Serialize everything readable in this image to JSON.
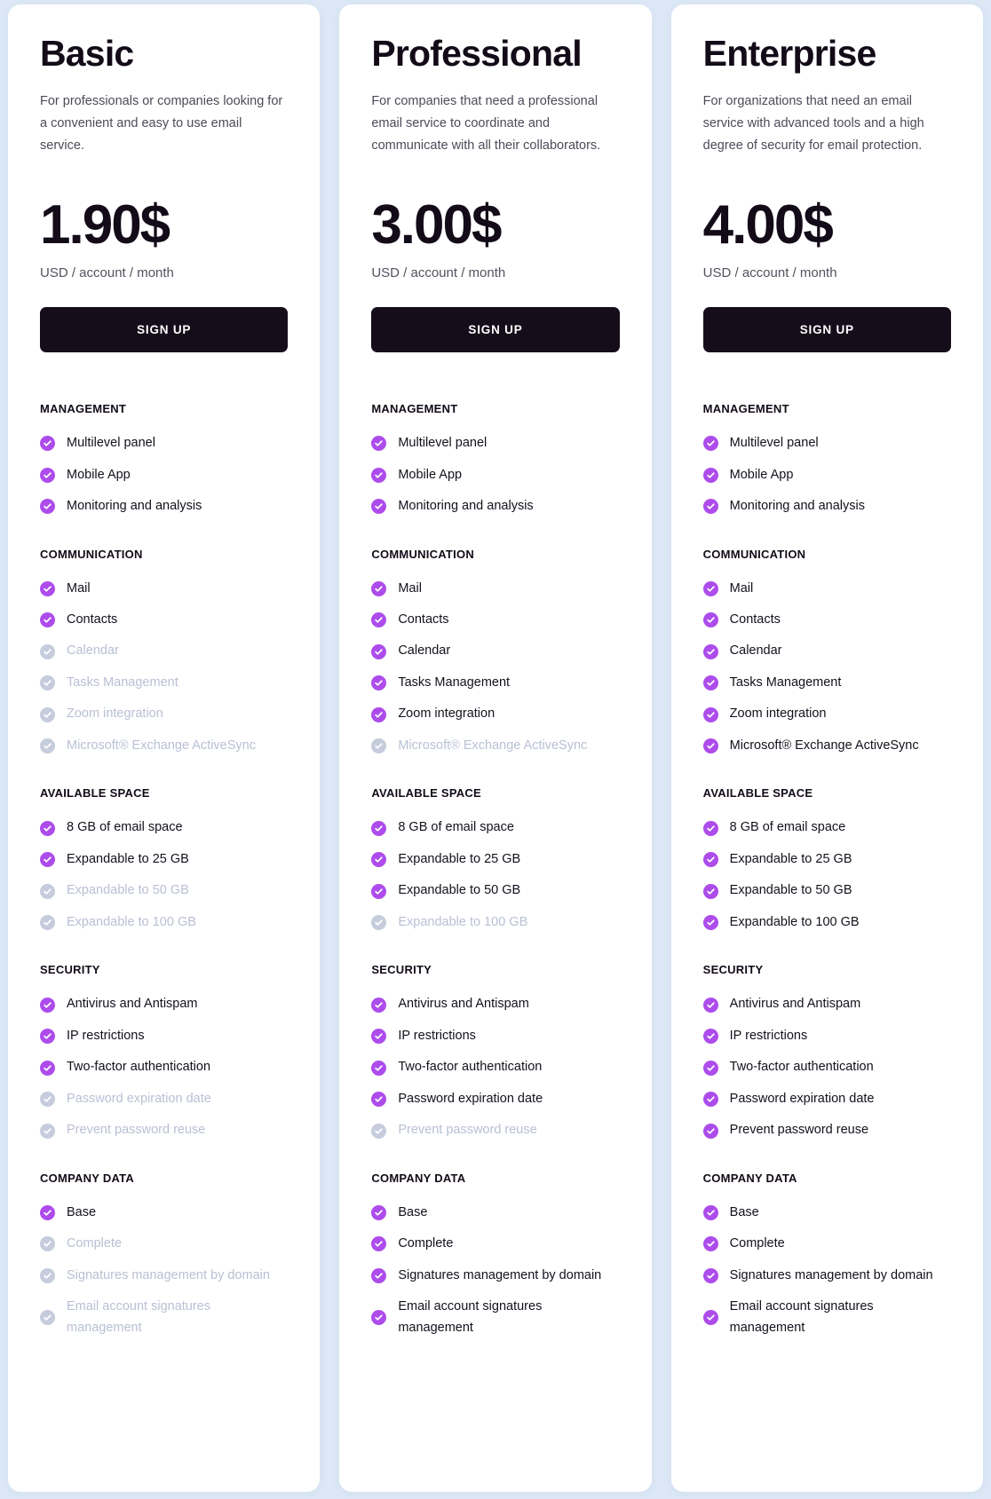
{
  "theme": {
    "page_background": "#dce8f6",
    "card_background": "#ffffff",
    "accent": "#ad4ceb",
    "disabled": "#c5ccdc",
    "button_background": "#150d1a",
    "heading_color": "#130b18"
  },
  "icons": {
    "check": "check-circle-icon"
  },
  "plans": [
    {
      "name": "Basic",
      "description": "For professionals or companies looking for a convenient and easy to use email service.",
      "price": "1.90$",
      "price_unit": "USD / account / month",
      "cta_label": "SIGN UP",
      "sections": [
        {
          "title": "MANAGEMENT",
          "features": [
            {
              "label": "Multilevel panel",
              "enabled": true
            },
            {
              "label": "Mobile App",
              "enabled": true
            },
            {
              "label": "Monitoring and analysis",
              "enabled": true
            }
          ]
        },
        {
          "title": "COMMUNICATION",
          "features": [
            {
              "label": "Mail",
              "enabled": true
            },
            {
              "label": "Contacts",
              "enabled": true
            },
            {
              "label": "Calendar",
              "enabled": false
            },
            {
              "label": "Tasks Management",
              "enabled": false
            },
            {
              "label": "Zoom integration",
              "enabled": false
            },
            {
              "label": "Microsoft® Exchange ActiveSync",
              "enabled": false
            }
          ]
        },
        {
          "title": "AVAILABLE SPACE",
          "features": [
            {
              "label": "8 GB of email space",
              "enabled": true
            },
            {
              "label": "Expandable to 25 GB",
              "enabled": true
            },
            {
              "label": "Expandable to 50 GB",
              "enabled": false
            },
            {
              "label": "Expandable to 100 GB",
              "enabled": false
            }
          ]
        },
        {
          "title": "SECURITY",
          "features": [
            {
              "label": "Antivirus and Antispam",
              "enabled": true
            },
            {
              "label": "IP restrictions",
              "enabled": true
            },
            {
              "label": "Two-factor authentication",
              "enabled": true
            },
            {
              "label": "Password expiration date",
              "enabled": false
            },
            {
              "label": "Prevent password reuse",
              "enabled": false
            }
          ]
        },
        {
          "title": "COMPANY DATA",
          "features": [
            {
              "label": "Base",
              "enabled": true
            },
            {
              "label": "Complete",
              "enabled": false
            },
            {
              "label": "Signatures management by domain",
              "enabled": false
            },
            {
              "label": "Email account signatures management",
              "enabled": false
            }
          ]
        }
      ]
    },
    {
      "name": "Professional",
      "description": "For companies that need a professional email service to coordinate and communicate with all their collaborators.",
      "price": "3.00$",
      "price_unit": "USD / account / month",
      "cta_label": "SIGN UP",
      "sections": [
        {
          "title": "MANAGEMENT",
          "features": [
            {
              "label": "Multilevel panel",
              "enabled": true
            },
            {
              "label": "Mobile App",
              "enabled": true
            },
            {
              "label": "Monitoring and analysis",
              "enabled": true
            }
          ]
        },
        {
          "title": "COMMUNICATION",
          "features": [
            {
              "label": "Mail",
              "enabled": true
            },
            {
              "label": "Contacts",
              "enabled": true
            },
            {
              "label": "Calendar",
              "enabled": true
            },
            {
              "label": "Tasks Management",
              "enabled": true
            },
            {
              "label": "Zoom integration",
              "enabled": true
            },
            {
              "label": "Microsoft® Exchange ActiveSync",
              "enabled": false
            }
          ]
        },
        {
          "title": "AVAILABLE SPACE",
          "features": [
            {
              "label": "8 GB of email space",
              "enabled": true
            },
            {
              "label": "Expandable to 25 GB",
              "enabled": true
            },
            {
              "label": "Expandable to 50 GB",
              "enabled": true
            },
            {
              "label": "Expandable to 100 GB",
              "enabled": false
            }
          ]
        },
        {
          "title": "SECURITY",
          "features": [
            {
              "label": "Antivirus and Antispam",
              "enabled": true
            },
            {
              "label": "IP restrictions",
              "enabled": true
            },
            {
              "label": "Two-factor authentication",
              "enabled": true
            },
            {
              "label": "Password expiration date",
              "enabled": true
            },
            {
              "label": "Prevent password reuse",
              "enabled": false
            }
          ]
        },
        {
          "title": "COMPANY DATA",
          "features": [
            {
              "label": "Base",
              "enabled": true
            },
            {
              "label": "Complete",
              "enabled": true
            },
            {
              "label": "Signatures management by domain",
              "enabled": true
            },
            {
              "label": "Email account signatures management",
              "enabled": true
            }
          ]
        }
      ]
    },
    {
      "name": "Enterprise",
      "description": "For organizations that need an email service with advanced tools and a high degree of security for email protection.",
      "price": "4.00$",
      "price_unit": "USD / account / month",
      "cta_label": "SIGN UP",
      "sections": [
        {
          "title": "MANAGEMENT",
          "features": [
            {
              "label": "Multilevel panel",
              "enabled": true
            },
            {
              "label": "Mobile App",
              "enabled": true
            },
            {
              "label": "Monitoring and analysis",
              "enabled": true
            }
          ]
        },
        {
          "title": "COMMUNICATION",
          "features": [
            {
              "label": "Mail",
              "enabled": true
            },
            {
              "label": "Contacts",
              "enabled": true
            },
            {
              "label": "Calendar",
              "enabled": true
            },
            {
              "label": "Tasks Management",
              "enabled": true
            },
            {
              "label": "Zoom integration",
              "enabled": true
            },
            {
              "label": "Microsoft® Exchange ActiveSync",
              "enabled": true
            }
          ]
        },
        {
          "title": "AVAILABLE SPACE",
          "features": [
            {
              "label": "8 GB of email space",
              "enabled": true
            },
            {
              "label": "Expandable to 25 GB",
              "enabled": true
            },
            {
              "label": "Expandable to 50 GB",
              "enabled": true
            },
            {
              "label": "Expandable to 100 GB",
              "enabled": true
            }
          ]
        },
        {
          "title": "SECURITY",
          "features": [
            {
              "label": "Antivirus and Antispam",
              "enabled": true
            },
            {
              "label": "IP restrictions",
              "enabled": true
            },
            {
              "label": "Two-factor authentication",
              "enabled": true
            },
            {
              "label": "Password expiration date",
              "enabled": true
            },
            {
              "label": "Prevent password reuse",
              "enabled": true
            }
          ]
        },
        {
          "title": "COMPANY DATA",
          "features": [
            {
              "label": "Base",
              "enabled": true
            },
            {
              "label": "Complete",
              "enabled": true
            },
            {
              "label": "Signatures management by domain",
              "enabled": true
            },
            {
              "label": "Email account signatures management",
              "enabled": true
            }
          ]
        }
      ]
    }
  ]
}
